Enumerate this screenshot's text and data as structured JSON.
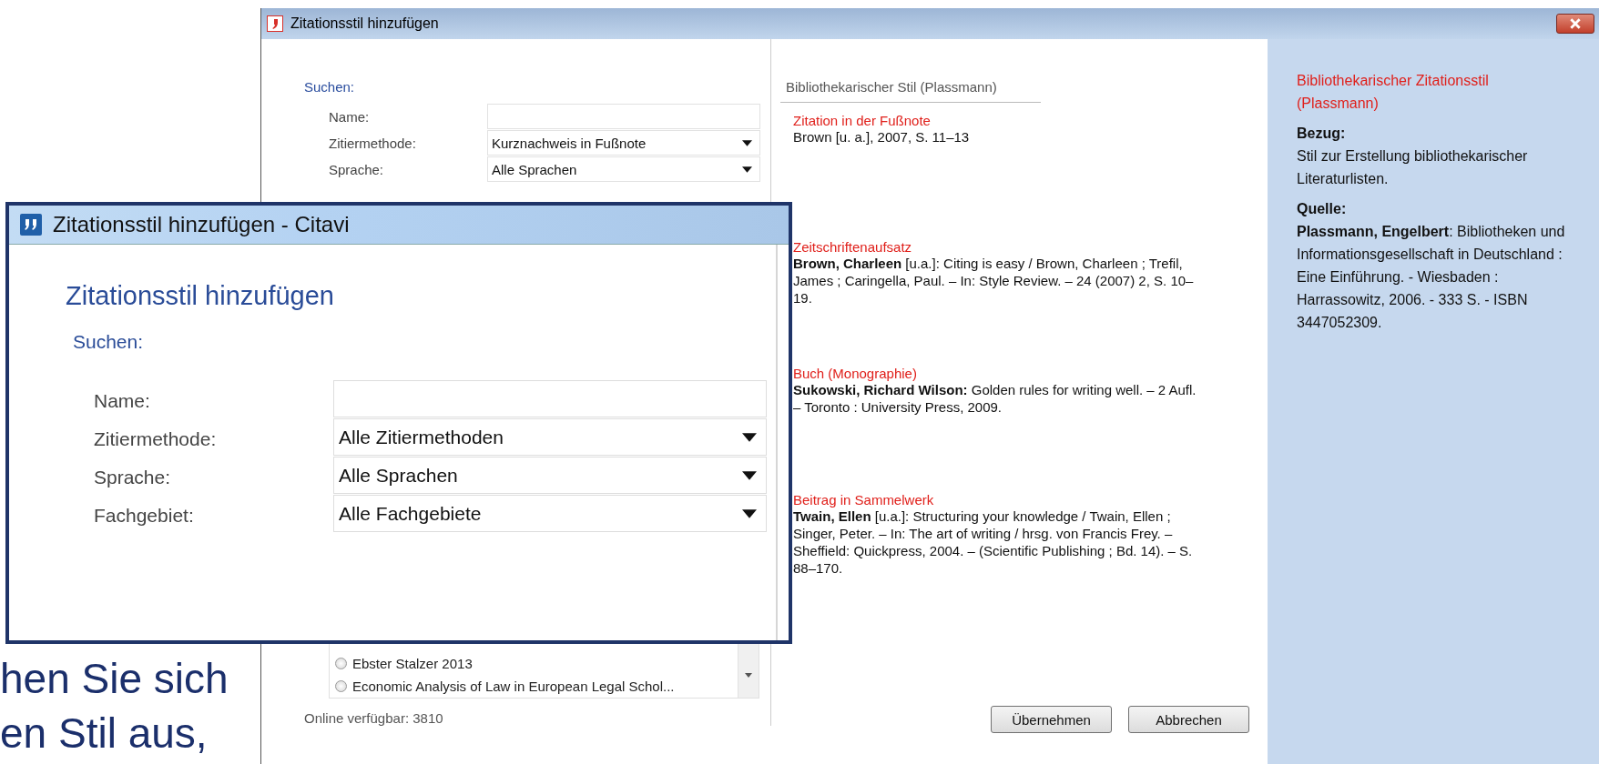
{
  "background_dialog": {
    "title": "Zitationsstil hinzufügen",
    "search_heading": "Suchen:",
    "fields": [
      {
        "label": "Name:",
        "kind": "text"
      },
      {
        "label": "Zitiermethode:",
        "kind": "dropdown",
        "value": "Kurznachweis in Fußnote"
      },
      {
        "label": "Sprache:",
        "kind": "dropdown",
        "value": "Alle Sprachen"
      }
    ],
    "styles": [
      {
        "name": "Ebster Stalzer 2013",
        "selected": false
      },
      {
        "name": "Economic Analysis of Law in European Legal Schol...",
        "selected": false
      }
    ],
    "online_count": "Online verfügbar: 3810",
    "preview": {
      "title": "Bibliothekarischer Stil (Plassmann)",
      "sections": [
        {
          "heading": "Zitation in der Fußnote",
          "text": "Brown [u. a.], 2007, S. 11–13"
        },
        {
          "heading": "Zeitschriftenaufsatz",
          "text": "**Brown, Charleen** [u.a.]: Citing is easy / Brown, Charleen ; Trefil, James ; Caringella, Paul. – In: Style Review. – 24 (2007) 2, S. 10–19."
        },
        {
          "heading": "Buch (Monographie)",
          "text": "**Sukowski, Richard Wilson:** Golden rules for writing well. – 2 Aufl. – Toronto : University Press, 2009."
        },
        {
          "heading": "Beitrag in Sammelwerk",
          "text": "**Twain, Ellen** [u.a.]: Structuring your knowledge / Twain, Ellen ; Singer, Peter. – In: The art of writing / hrsg. von Francis Frey. – Sheffield: Quickpress, 2004. – (Scientific Publishing ; Bd. 14). – S. 88–170."
        }
      ]
    },
    "info": {
      "title": "Bibliothekarischer Zitationsstil (Plassmann)",
      "sections": [
        {
          "heading": "Bezug:",
          "text": "Stil zur Erstellung bibliothekarischer Literaturlisten."
        },
        {
          "heading": "Quelle:",
          "text": "**Plassmann, Engelbert**: Bibliotheken und Informationsgesellschaft in Deutschland : Eine Einführung. - Wiesbaden : Harrassowitz, 2006. - 333 S. - ISBN 3447052309."
        }
      ]
    },
    "buttons": [
      "Übernehmen",
      "Abbrechen"
    ]
  },
  "zoomed_dialog": {
    "title": "Zitationsstil hinzufügen - Citavi",
    "heading": "Zitationsstil hinzufügen",
    "search_heading": "Suchen:",
    "fields": [
      {
        "label": "Name:",
        "kind": "text"
      },
      {
        "label": "Zitiermethode:",
        "kind": "dropdown",
        "value": "Alle Zitiermethoden"
      },
      {
        "label": "Sprache:",
        "kind": "dropdown",
        "value": "Alle Sprachen"
      },
      {
        "label": "Fachgebiet:",
        "kind": "dropdown",
        "value": "Alle Fachgebiete"
      }
    ]
  },
  "slide_text": [
    "hen Sie sich",
    "en Stil aus,"
  ]
}
